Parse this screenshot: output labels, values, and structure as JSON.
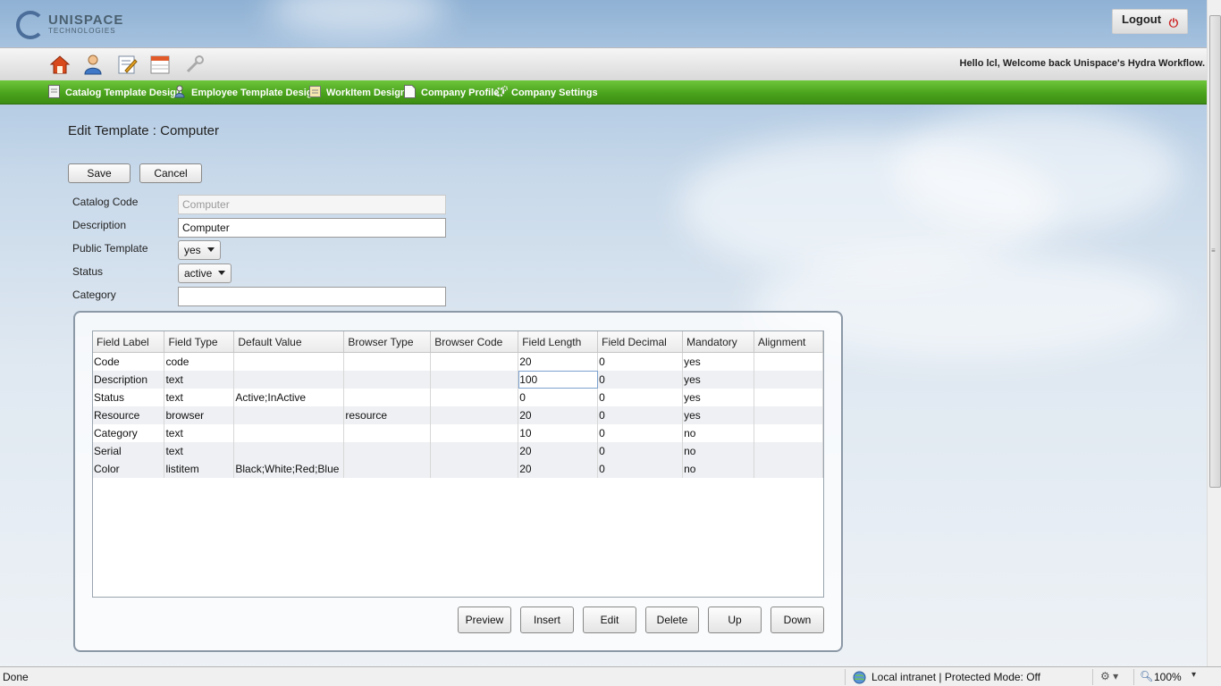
{
  "header": {
    "logo_name": "UNISPACE",
    "logo_sub": "TECHNOLOGIES",
    "logout_label": "Logout",
    "welcome_text": "Hello lcl, Welcome back Unispace's Hydra Workflow."
  },
  "toolbar_icons": [
    "home-icon",
    "user-icon",
    "edit-icon",
    "calendar-icon",
    "tools-icon"
  ],
  "nav": {
    "items": [
      {
        "label": "Catalog Template Design",
        "icon": "document-icon"
      },
      {
        "label": "Employee Template Design",
        "icon": "employee-icon"
      },
      {
        "label": "WorkItem Design",
        "icon": "workitem-icon"
      },
      {
        "label": "Company Profile",
        "icon": "page-icon"
      },
      {
        "label": "Company Settings",
        "icon": "gears-icon"
      }
    ]
  },
  "page": {
    "title": "Edit Template : Computer",
    "save_label": "Save",
    "cancel_label": "Cancel"
  },
  "form": {
    "catalog_code_label": "Catalog Code",
    "catalog_code_value": "Computer",
    "description_label": "Description",
    "description_value": "Computer",
    "public_label": "Public Template",
    "public_value": "yes",
    "status_label": "Status",
    "status_value": "active",
    "category_label": "Category",
    "category_value": ""
  },
  "grid": {
    "columns": [
      "Field Label",
      "Field Type",
      "Default Value",
      "Browser Type",
      "Browser Code",
      "Field Length",
      "Field Decimal",
      "Mandatory",
      "Alignment"
    ],
    "rows": [
      [
        "Code",
        "code",
        "",
        "",
        "",
        "20",
        "0",
        "yes",
        ""
      ],
      [
        "Description",
        "text",
        "",
        "",
        "",
        "100",
        "0",
        "yes",
        ""
      ],
      [
        "Status",
        "text",
        "Active;InActive",
        "",
        "",
        "0",
        "0",
        "yes",
        ""
      ],
      [
        "Resource",
        "browser",
        "",
        "resource",
        "",
        "20",
        "0",
        "yes",
        ""
      ],
      [
        "Category",
        "text",
        "",
        "",
        "",
        "10",
        "0",
        "no",
        ""
      ],
      [
        "Serial",
        "text",
        "",
        "",
        "",
        "20",
        "0",
        "no",
        ""
      ],
      [
        "Color",
        "listitem",
        "Black;White;Red;Blue",
        "",
        "",
        "20",
        "0",
        "no",
        ""
      ]
    ]
  },
  "grid_buttons": {
    "preview": "Preview",
    "insert": "Insert",
    "edit": "Edit",
    "delete": "Delete",
    "up": "Up",
    "down": "Down"
  },
  "statusbar": {
    "left": "Done",
    "zone": "Local intranet | Protected Mode: Off",
    "zoom": "100%"
  },
  "colors": {
    "nav_green": "#4aa31c",
    "accent_blue": "#4a6d9a"
  }
}
